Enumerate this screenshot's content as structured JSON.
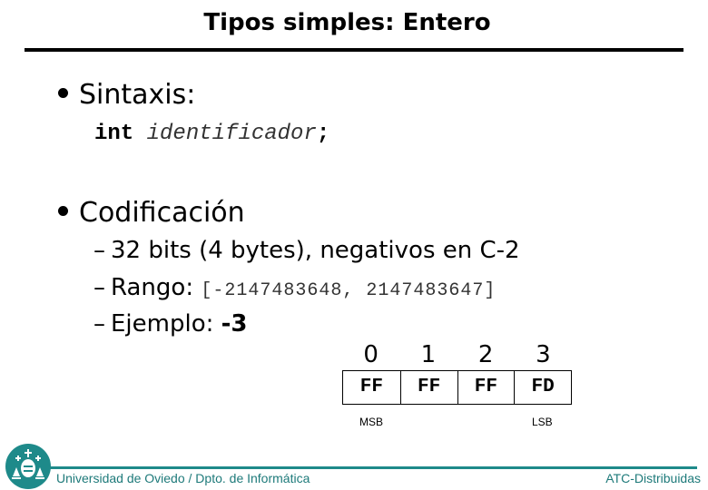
{
  "slide": {
    "title": "Tipos simples: Entero",
    "bullets": [
      {
        "label": "Sintaxis:",
        "code": {
          "keyword": "int",
          "identifier": "identificador",
          "terminator": ";"
        }
      },
      {
        "label": "Codificación",
        "subitems": [
          {
            "dash": "–",
            "text": "32 bits (4 bytes), negativos en C-2"
          },
          {
            "dash": "–",
            "label": "Rango:",
            "value": "[-2147483648, 2147483647]"
          },
          {
            "dash": "–",
            "label": "Ejemplo:",
            "value": "-3"
          }
        ]
      }
    ],
    "byte_table": {
      "indices": [
        "0",
        "1",
        "2",
        "3"
      ],
      "bytes": [
        "FF",
        "FF",
        "FF",
        "FD"
      ],
      "msb_label": "MSB",
      "lsb_label": "LSB"
    }
  },
  "footer": {
    "left": "Universidad de Oviedo / Dpto. de Informática",
    "right": "ATC-Distribuidas",
    "logo_icon": "university-crest-icon",
    "accent_color": "#1e8a8a"
  }
}
